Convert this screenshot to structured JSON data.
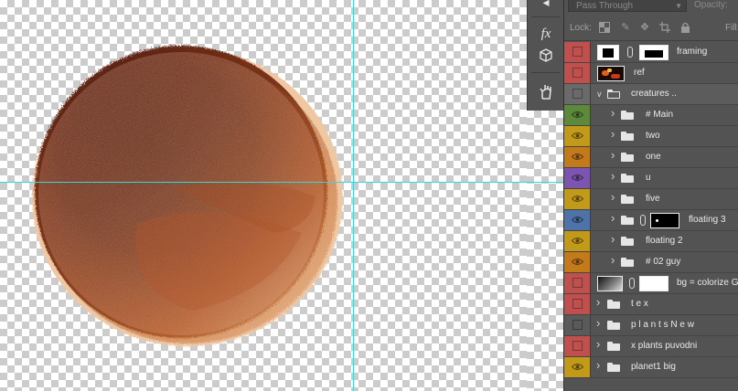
{
  "layers_panel": {
    "blend_mode": "Pass Through",
    "opacity_label": "Opacity:",
    "lock_label": "Lock:",
    "fill_label": "Fill:",
    "layers": [
      {
        "name": "framing",
        "color": "#c0504d",
        "visible": false,
        "kind": "masked"
      },
      {
        "name": "ref",
        "color": "#c0504d",
        "visible": false,
        "kind": "image"
      },
      {
        "name": "creatures ..",
        "color": "#6a6a6a",
        "visible": false,
        "kind": "group-open"
      },
      {
        "name": "# Main",
        "color": "#5d8a3a",
        "visible": true,
        "kind": "group"
      },
      {
        "name": "two",
        "color": "#c29a1a",
        "visible": true,
        "kind": "group"
      },
      {
        "name": "one",
        "color": "#c27a1a",
        "visible": true,
        "kind": "group"
      },
      {
        "name": "u",
        "color": "#7b55b0",
        "visible": true,
        "kind": "group"
      },
      {
        "name": "five",
        "color": "#c29a1a",
        "visible": true,
        "kind": "group"
      },
      {
        "name": "floating 3",
        "color": "#4f73a8",
        "visible": true,
        "kind": "group-masked"
      },
      {
        "name": "floating 2",
        "color": "#c29a1a",
        "visible": true,
        "kind": "group"
      },
      {
        "name": "# 02 guy",
        "color": "#c27a1a",
        "visible": true,
        "kind": "group"
      },
      {
        "name": "bg = colorize G",
        "color": "#c0504d",
        "visible": false,
        "kind": "adjustment"
      },
      {
        "name": "t e x",
        "color": "#c0504d",
        "visible": false,
        "kind": "group-top"
      },
      {
        "name": "p l a n t s  N e w",
        "color": "#5a5a5a",
        "visible": false,
        "kind": "group-top"
      },
      {
        "name": "x plants puvodni",
        "color": "#c0504d",
        "visible": false,
        "kind": "group-top"
      },
      {
        "name": "planet1 big",
        "color": "#c29a1a",
        "visible": true,
        "kind": "group-top"
      }
    ]
  },
  "tools": {
    "icons": [
      "fx-icon",
      "3d-cube-icon",
      "puppet-warp-icon"
    ]
  },
  "canvas": {
    "guide_color": "#38d7e0"
  }
}
